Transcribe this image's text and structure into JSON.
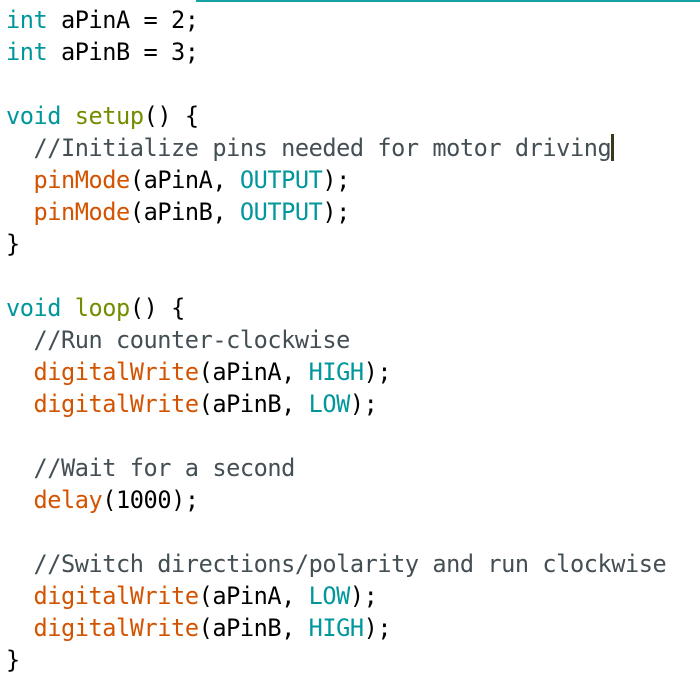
{
  "colors": {
    "keyword": "#00979c",
    "function": "#d35400",
    "structure": "#728e00",
    "comment": "#434f54"
  },
  "code": {
    "lines": [
      [
        {
          "t": "int",
          "k": "kw"
        },
        {
          "t": " aPinA = 2;",
          "k": "pl"
        }
      ],
      [
        {
          "t": "int",
          "k": "kw"
        },
        {
          "t": " aPinB = 3;",
          "k": "pl"
        }
      ],
      [],
      [
        {
          "t": "void",
          "k": "kw"
        },
        {
          "t": " ",
          "k": "pl"
        },
        {
          "t": "setup",
          "k": "st"
        },
        {
          "t": "() {",
          "k": "pl"
        }
      ],
      [
        {
          "t": "  //Initialize pins needed for motor driving",
          "k": "cm"
        }
      ],
      [
        {
          "t": "  ",
          "k": "pl"
        },
        {
          "t": "pinMode",
          "k": "fn"
        },
        {
          "t": "(aPinA, ",
          "k": "pl"
        },
        {
          "t": "OUTPUT",
          "k": "kw"
        },
        {
          "t": ");",
          "k": "pl"
        }
      ],
      [
        {
          "t": "  ",
          "k": "pl"
        },
        {
          "t": "pinMode",
          "k": "fn"
        },
        {
          "t": "(aPinB, ",
          "k": "pl"
        },
        {
          "t": "OUTPUT",
          "k": "kw"
        },
        {
          "t": ");",
          "k": "pl"
        }
      ],
      [
        {
          "t": "}",
          "k": "pl"
        }
      ],
      [],
      [
        {
          "t": "void",
          "k": "kw"
        },
        {
          "t": " ",
          "k": "pl"
        },
        {
          "t": "loop",
          "k": "st"
        },
        {
          "t": "() {",
          "k": "pl"
        }
      ],
      [
        {
          "t": "  //Run counter-clockwise",
          "k": "cm"
        }
      ],
      [
        {
          "t": "  ",
          "k": "pl"
        },
        {
          "t": "digitalWrite",
          "k": "fn"
        },
        {
          "t": "(aPinA, ",
          "k": "pl"
        },
        {
          "t": "HIGH",
          "k": "kw"
        },
        {
          "t": ");",
          "k": "pl"
        }
      ],
      [
        {
          "t": "  ",
          "k": "pl"
        },
        {
          "t": "digitalWrite",
          "k": "fn"
        },
        {
          "t": "(aPinB, ",
          "k": "pl"
        },
        {
          "t": "LOW",
          "k": "kw"
        },
        {
          "t": ");",
          "k": "pl"
        }
      ],
      [],
      [
        {
          "t": "  //Wait for a second",
          "k": "cm"
        }
      ],
      [
        {
          "t": "  ",
          "k": "pl"
        },
        {
          "t": "delay",
          "k": "fn"
        },
        {
          "t": "(1000);",
          "k": "pl"
        }
      ],
      [],
      [
        {
          "t": "  //Switch directions/polarity and run clockwise",
          "k": "cm"
        }
      ],
      [
        {
          "t": "  ",
          "k": "pl"
        },
        {
          "t": "digitalWrite",
          "k": "fn"
        },
        {
          "t": "(aPinA, ",
          "k": "pl"
        },
        {
          "t": "LOW",
          "k": "kw"
        },
        {
          "t": ");",
          "k": "pl"
        }
      ],
      [
        {
          "t": "  ",
          "k": "pl"
        },
        {
          "t": "digitalWrite",
          "k": "fn"
        },
        {
          "t": "(aPinB, ",
          "k": "pl"
        },
        {
          "t": "HIGH",
          "k": "kw"
        },
        {
          "t": ");",
          "k": "pl"
        }
      ],
      [
        {
          "t": "}",
          "k": "pl"
        }
      ]
    ],
    "caret_line": 4
  }
}
